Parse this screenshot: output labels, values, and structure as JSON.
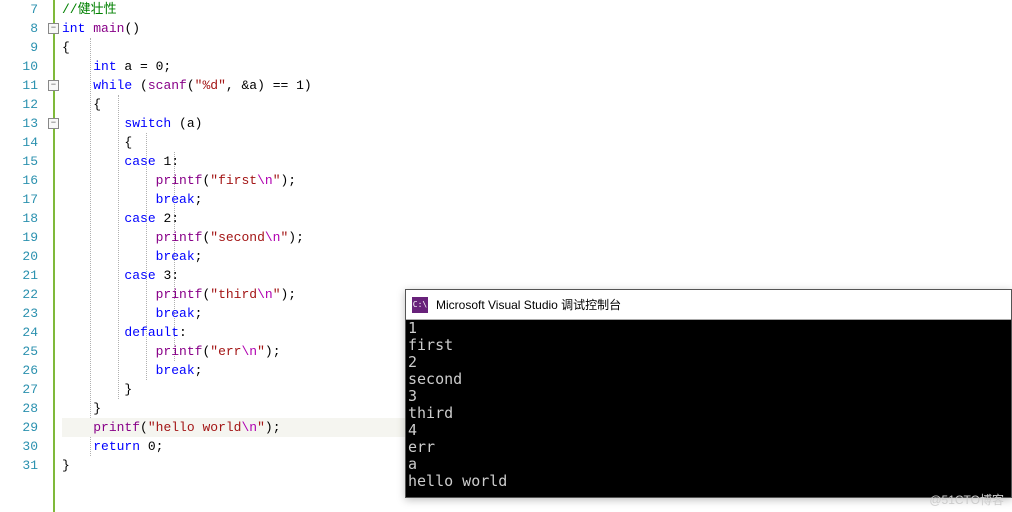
{
  "gutter": {
    "start": 7,
    "end": 31
  },
  "fold_markers": [
    {
      "line": 8,
      "sym": "−"
    },
    {
      "line": 11,
      "sym": "−"
    },
    {
      "line": 13,
      "sym": "−"
    }
  ],
  "code": {
    "l7": {
      "comment": "//健壮性"
    },
    "l8": {
      "kw1": "int",
      "kw2": "main",
      "rest": "()"
    },
    "l9": {
      "brace": "{"
    },
    "l10": {
      "kw": "int",
      "rest": " a = 0;"
    },
    "l11": {
      "kw": "while",
      "paren_open": " (",
      "fn": "scanf",
      "po": "(",
      "str": "\"%d\"",
      "rest": ", &a) == 1)"
    },
    "l12": {
      "brace": "{"
    },
    "l13": {
      "kw": "switch",
      "rest": " (a)"
    },
    "l14": {
      "brace": "{"
    },
    "l15": {
      "kw": "case",
      "rest": " 1:"
    },
    "l16": {
      "fn": "printf",
      "po": "(",
      "q1": "\"",
      "txt": "first",
      "esc": "\\n",
      "q2": "\"",
      "pc": ");"
    },
    "l17": {
      "kw": "break",
      "semi": ";"
    },
    "l18": {
      "kw": "case",
      "rest": " 2:"
    },
    "l19": {
      "fn": "printf",
      "po": "(",
      "q1": "\"",
      "txt": "second",
      "esc": "\\n",
      "q2": "\"",
      "pc": ");"
    },
    "l20": {
      "kw": "break",
      "semi": ";"
    },
    "l21": {
      "kw": "case",
      "rest": " 3:"
    },
    "l22": {
      "fn": "printf",
      "po": "(",
      "q1": "\"",
      "txt": "third",
      "esc": "\\n",
      "q2": "\"",
      "pc": ");"
    },
    "l23": {
      "kw": "break",
      "semi": ";"
    },
    "l24": {
      "kw": "default",
      "rest": ":"
    },
    "l25": {
      "fn": "printf",
      "po": "(",
      "q1": "\"",
      "txt": "err",
      "esc": "\\n",
      "q2": "\"",
      "pc": ");"
    },
    "l26": {
      "kw": "break",
      "semi": ";"
    },
    "l27": {
      "brace": "}"
    },
    "l28": {
      "brace": "}"
    },
    "l29": {
      "fn": "printf",
      "po": "(",
      "q1": "\"",
      "txt": "hello world",
      "esc": "\\n",
      "q2": "\"",
      "pc": ");"
    },
    "l30": {
      "kw": "return",
      "rest": " 0;"
    },
    "l31": {
      "brace": "}"
    }
  },
  "console": {
    "icon_text": "C:\\",
    "title": "Microsoft Visual Studio 调试控制台",
    "lines": [
      "1",
      "first",
      "2",
      "second",
      "3",
      "third",
      "4",
      "err",
      "a",
      "hello world"
    ]
  },
  "watermark": "@51CTO博客"
}
